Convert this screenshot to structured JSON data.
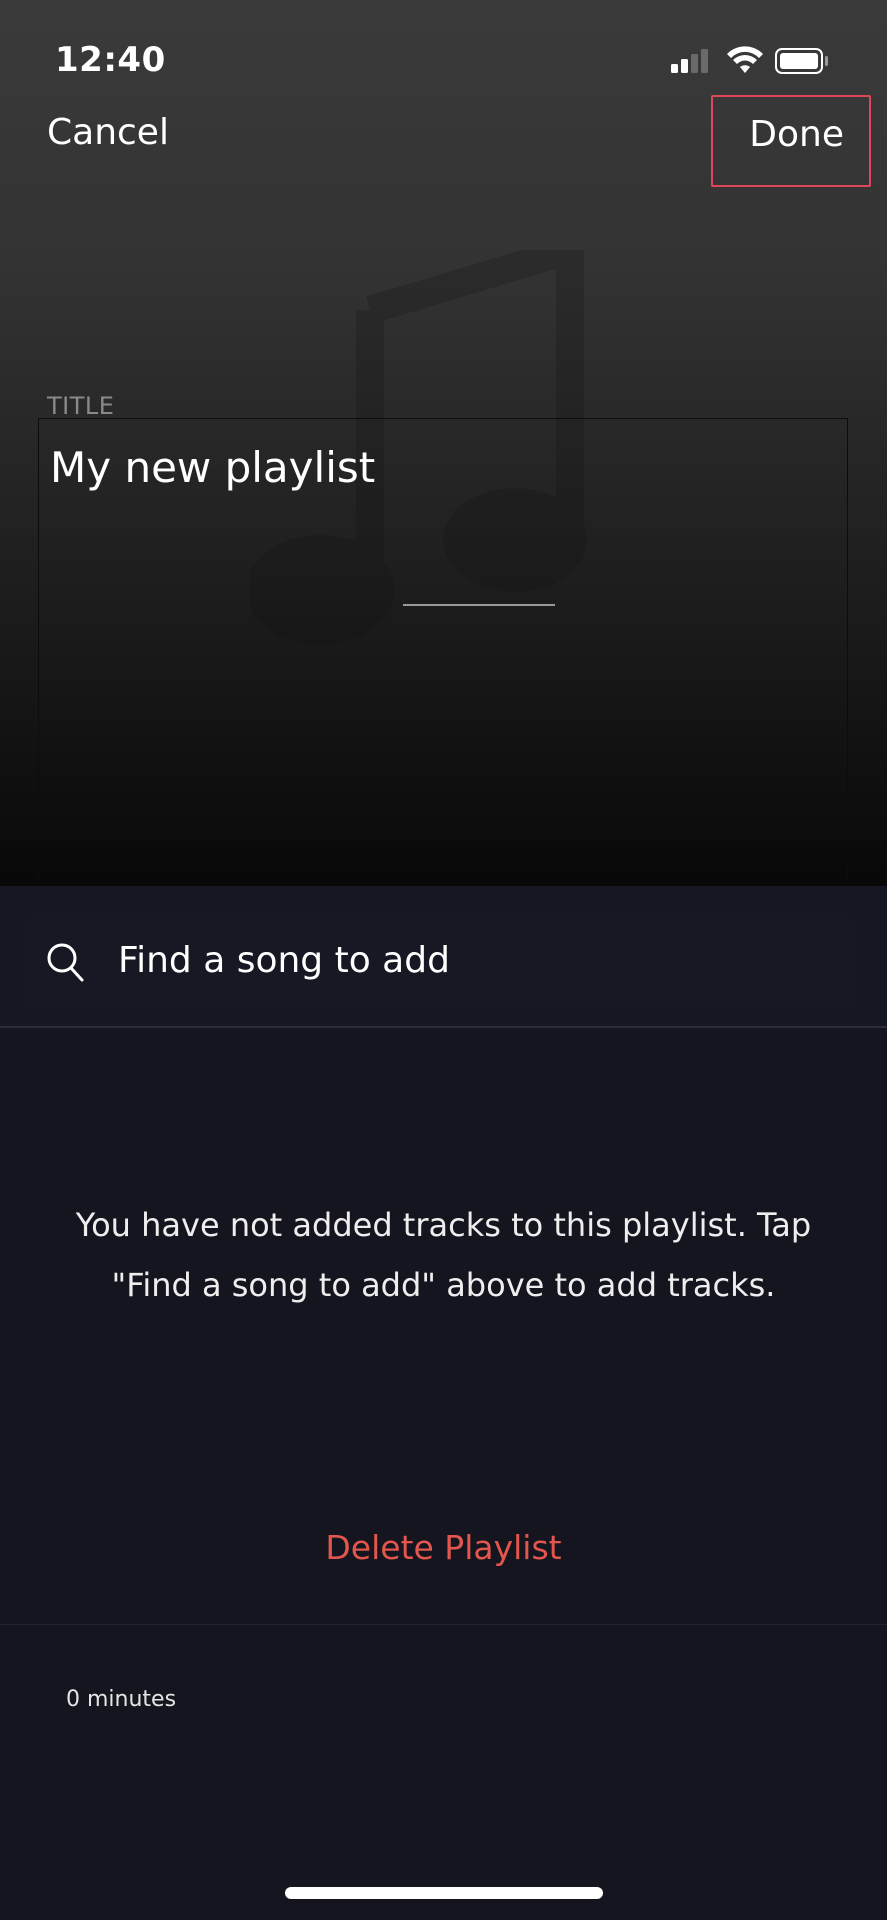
{
  "status_bar": {
    "time": "12:40"
  },
  "nav": {
    "cancel_label": "Cancel",
    "done_label": "Done"
  },
  "title_section": {
    "label": "TITLE",
    "value": "My new playlist"
  },
  "search": {
    "placeholder": "Find a song to add",
    "icon": "search-icon"
  },
  "empty_state": {
    "message": "You have not added tracks to this playlist. Tap \"Find a song to add\" above to add tracks."
  },
  "actions": {
    "delete_label": "Delete Playlist"
  },
  "footer": {
    "duration": "0 minutes"
  },
  "colors": {
    "accent_red": "#e2564e",
    "highlight_border": "#e0465a",
    "background": "#14151e"
  }
}
